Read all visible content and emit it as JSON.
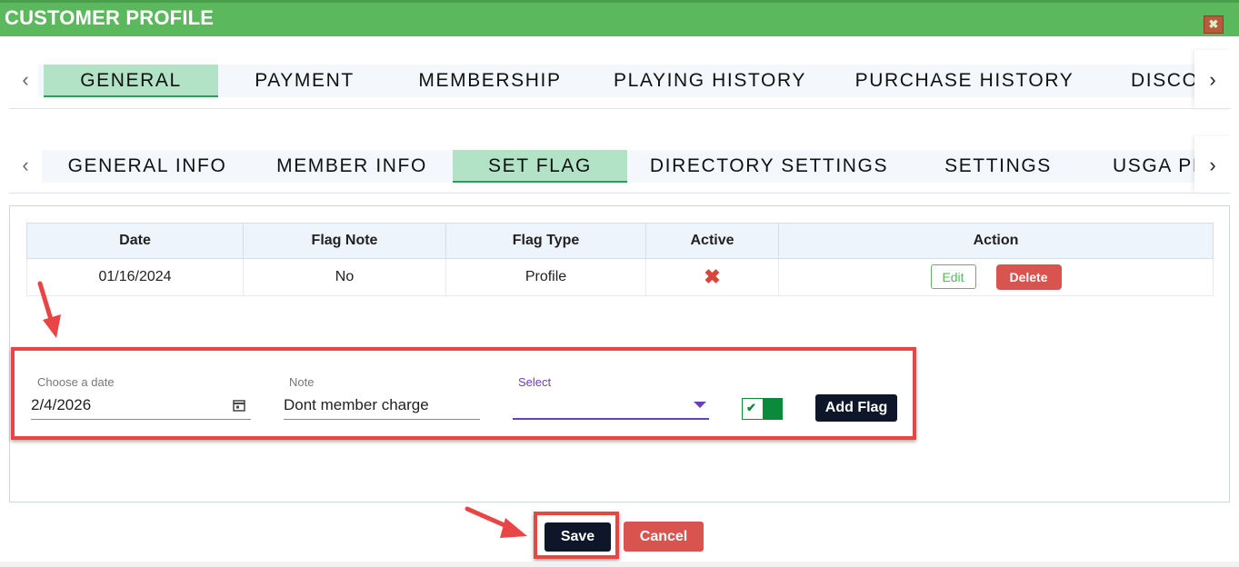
{
  "header": {
    "title": "CUSTOMER PROFILE",
    "close_glyph": "✖"
  },
  "main_tabs": {
    "items": [
      {
        "label": "GENERAL"
      },
      {
        "label": "PAYMENT"
      },
      {
        "label": "MEMBERSHIP"
      },
      {
        "label": "PLAYING HISTORY"
      },
      {
        "label": "PURCHASE HISTORY"
      },
      {
        "label": "DISCO"
      }
    ],
    "active": "GENERAL"
  },
  "sub_tabs": {
    "items": [
      {
        "label": "GENERAL INFO"
      },
      {
        "label": "MEMBER INFO"
      },
      {
        "label": "SET FLAG"
      },
      {
        "label": "DIRECTORY SETTINGS"
      },
      {
        "label": "SETTINGS"
      },
      {
        "label": "USGA PI"
      }
    ],
    "active": "SET FLAG"
  },
  "icons": {
    "prev": "chevron-left-icon",
    "next": "chevron-right-icon",
    "calendar": "calendar-icon",
    "inactive": "x-mark-icon",
    "toggle": "check-icon"
  },
  "flags_table": {
    "headers": [
      "Date",
      "Flag Note",
      "Flag Type",
      "Active",
      "Action"
    ],
    "rows": [
      {
        "date": "01/16/2024",
        "note": "No",
        "type": "Profile",
        "active": "✖",
        "edit": "Edit",
        "delete": "Delete"
      }
    ]
  },
  "add_flag_form": {
    "date_label": "Choose a date",
    "date_value": "2/4/2026",
    "note_label": "Note",
    "note_value": "Dont member charge",
    "select_label": "Select",
    "select_value": "",
    "active_toggle": true,
    "add_button": "Add Flag"
  },
  "footer": {
    "save_label": "Save",
    "cancel_label": "Cancel"
  },
  "colors": {
    "header_green": "#5cb85c",
    "active_tab": "#b3e3c6",
    "danger": "#d9534f",
    "dark_button": "#0e1629",
    "annotation_red": "#ea4545",
    "select_purple": "#6b3fb8"
  }
}
